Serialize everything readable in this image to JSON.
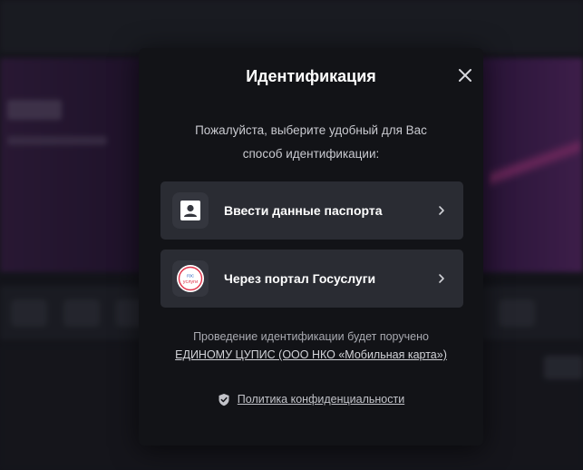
{
  "modal": {
    "title": "Идентификация",
    "subtitle_line1": "Пожалуйста, выберите удобный для Вас",
    "subtitle_line2": "способ идентификации:",
    "options": [
      {
        "label": "Ввести данные паспорта",
        "icon": "id-card-icon"
      },
      {
        "label": "Через портал Госуслуги",
        "icon": "gosuslugi-logo-icon",
        "logo_text_top": "гос",
        "logo_text_bottom": "услуги"
      }
    ],
    "footer_line1": "Проведение идентификации будет поручено",
    "footer_link": "ЕДИНОМУ ЦУПИС (ООО НКО «Мобильная карта»)",
    "privacy_label": "Политика конфиденциальности"
  },
  "colors": {
    "modal_bg": "#121317",
    "option_bg": "#2a2c33",
    "gosuslugi_blue": "#1f5bbd",
    "gosuslugi_red": "#e0334a"
  }
}
